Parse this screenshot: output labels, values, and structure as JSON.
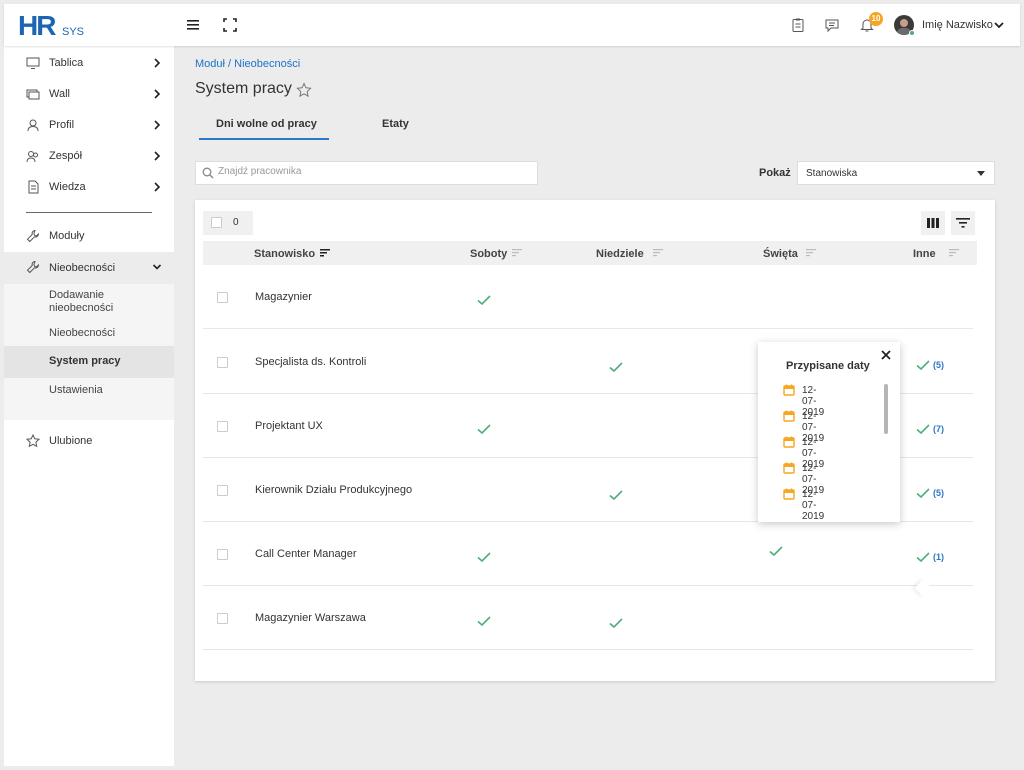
{
  "app": {
    "logo_main": "HR",
    "logo_sub": "SYS"
  },
  "topbar": {
    "user_name": "Imię Nazwisko",
    "notification_count": "10"
  },
  "sidebar": {
    "items": [
      {
        "label": "Tablica",
        "icon": "monitor-icon"
      },
      {
        "label": "Wall",
        "icon": "wall-icon"
      },
      {
        "label": "Profil",
        "icon": "user-icon"
      },
      {
        "label": "Zespół",
        "icon": "team-icon"
      },
      {
        "label": "Wiedza",
        "icon": "document-icon"
      }
    ],
    "moduly": "Moduły",
    "nieobecnosci": "Nieobecności",
    "subitems": [
      "Dodawanie nieobecności",
      "Nieobecności",
      "System pracy",
      "Ustawienia"
    ],
    "ulubione": "Ulubione"
  },
  "main": {
    "breadcrumb": "Moduł / Nieobecności",
    "title": "System pracy",
    "tabs": [
      "Dni wolne od pracy",
      "Etaty"
    ],
    "search_placeholder": "Znajdź pracownika",
    "show_label": "Pokaż",
    "show_value": "Stanowiska",
    "selected_count": "0",
    "columns": [
      "Stanowisko",
      "Soboty",
      "Niedziele",
      "Święta",
      "Inne"
    ]
  },
  "rows": [
    {
      "name": "Magazynier",
      "soboty": true,
      "niedziele": false,
      "swieta": false,
      "inne": ""
    },
    {
      "name": "Specjalista ds. Kontroli",
      "soboty": false,
      "niedziele": true,
      "swieta": false,
      "inne": "(5)"
    },
    {
      "name": "Projektant UX",
      "soboty": true,
      "niedziele": false,
      "swieta": false,
      "inne": "(7)"
    },
    {
      "name": "Kierownik Działu Produkcyjnego",
      "soboty": false,
      "niedziele": true,
      "swieta": false,
      "inne": "(5)"
    },
    {
      "name": "Call Center Manager",
      "soboty": true,
      "niedziele": false,
      "swieta": true,
      "inne": "(1)"
    },
    {
      "name": "Magazynier Warszawa",
      "soboty": true,
      "niedziele": true,
      "swieta": false,
      "inne": ""
    }
  ],
  "popup": {
    "title": "Przypisane daty",
    "dates": [
      "12-07-2019",
      "12-07-2019",
      "12-07-2019",
      "12-07-2019",
      "12-07-2019"
    ]
  },
  "colors": {
    "accent": "#2b78c4",
    "check": "#4caf7d",
    "calendar": "#f5a623",
    "badge": "#f5a623"
  }
}
